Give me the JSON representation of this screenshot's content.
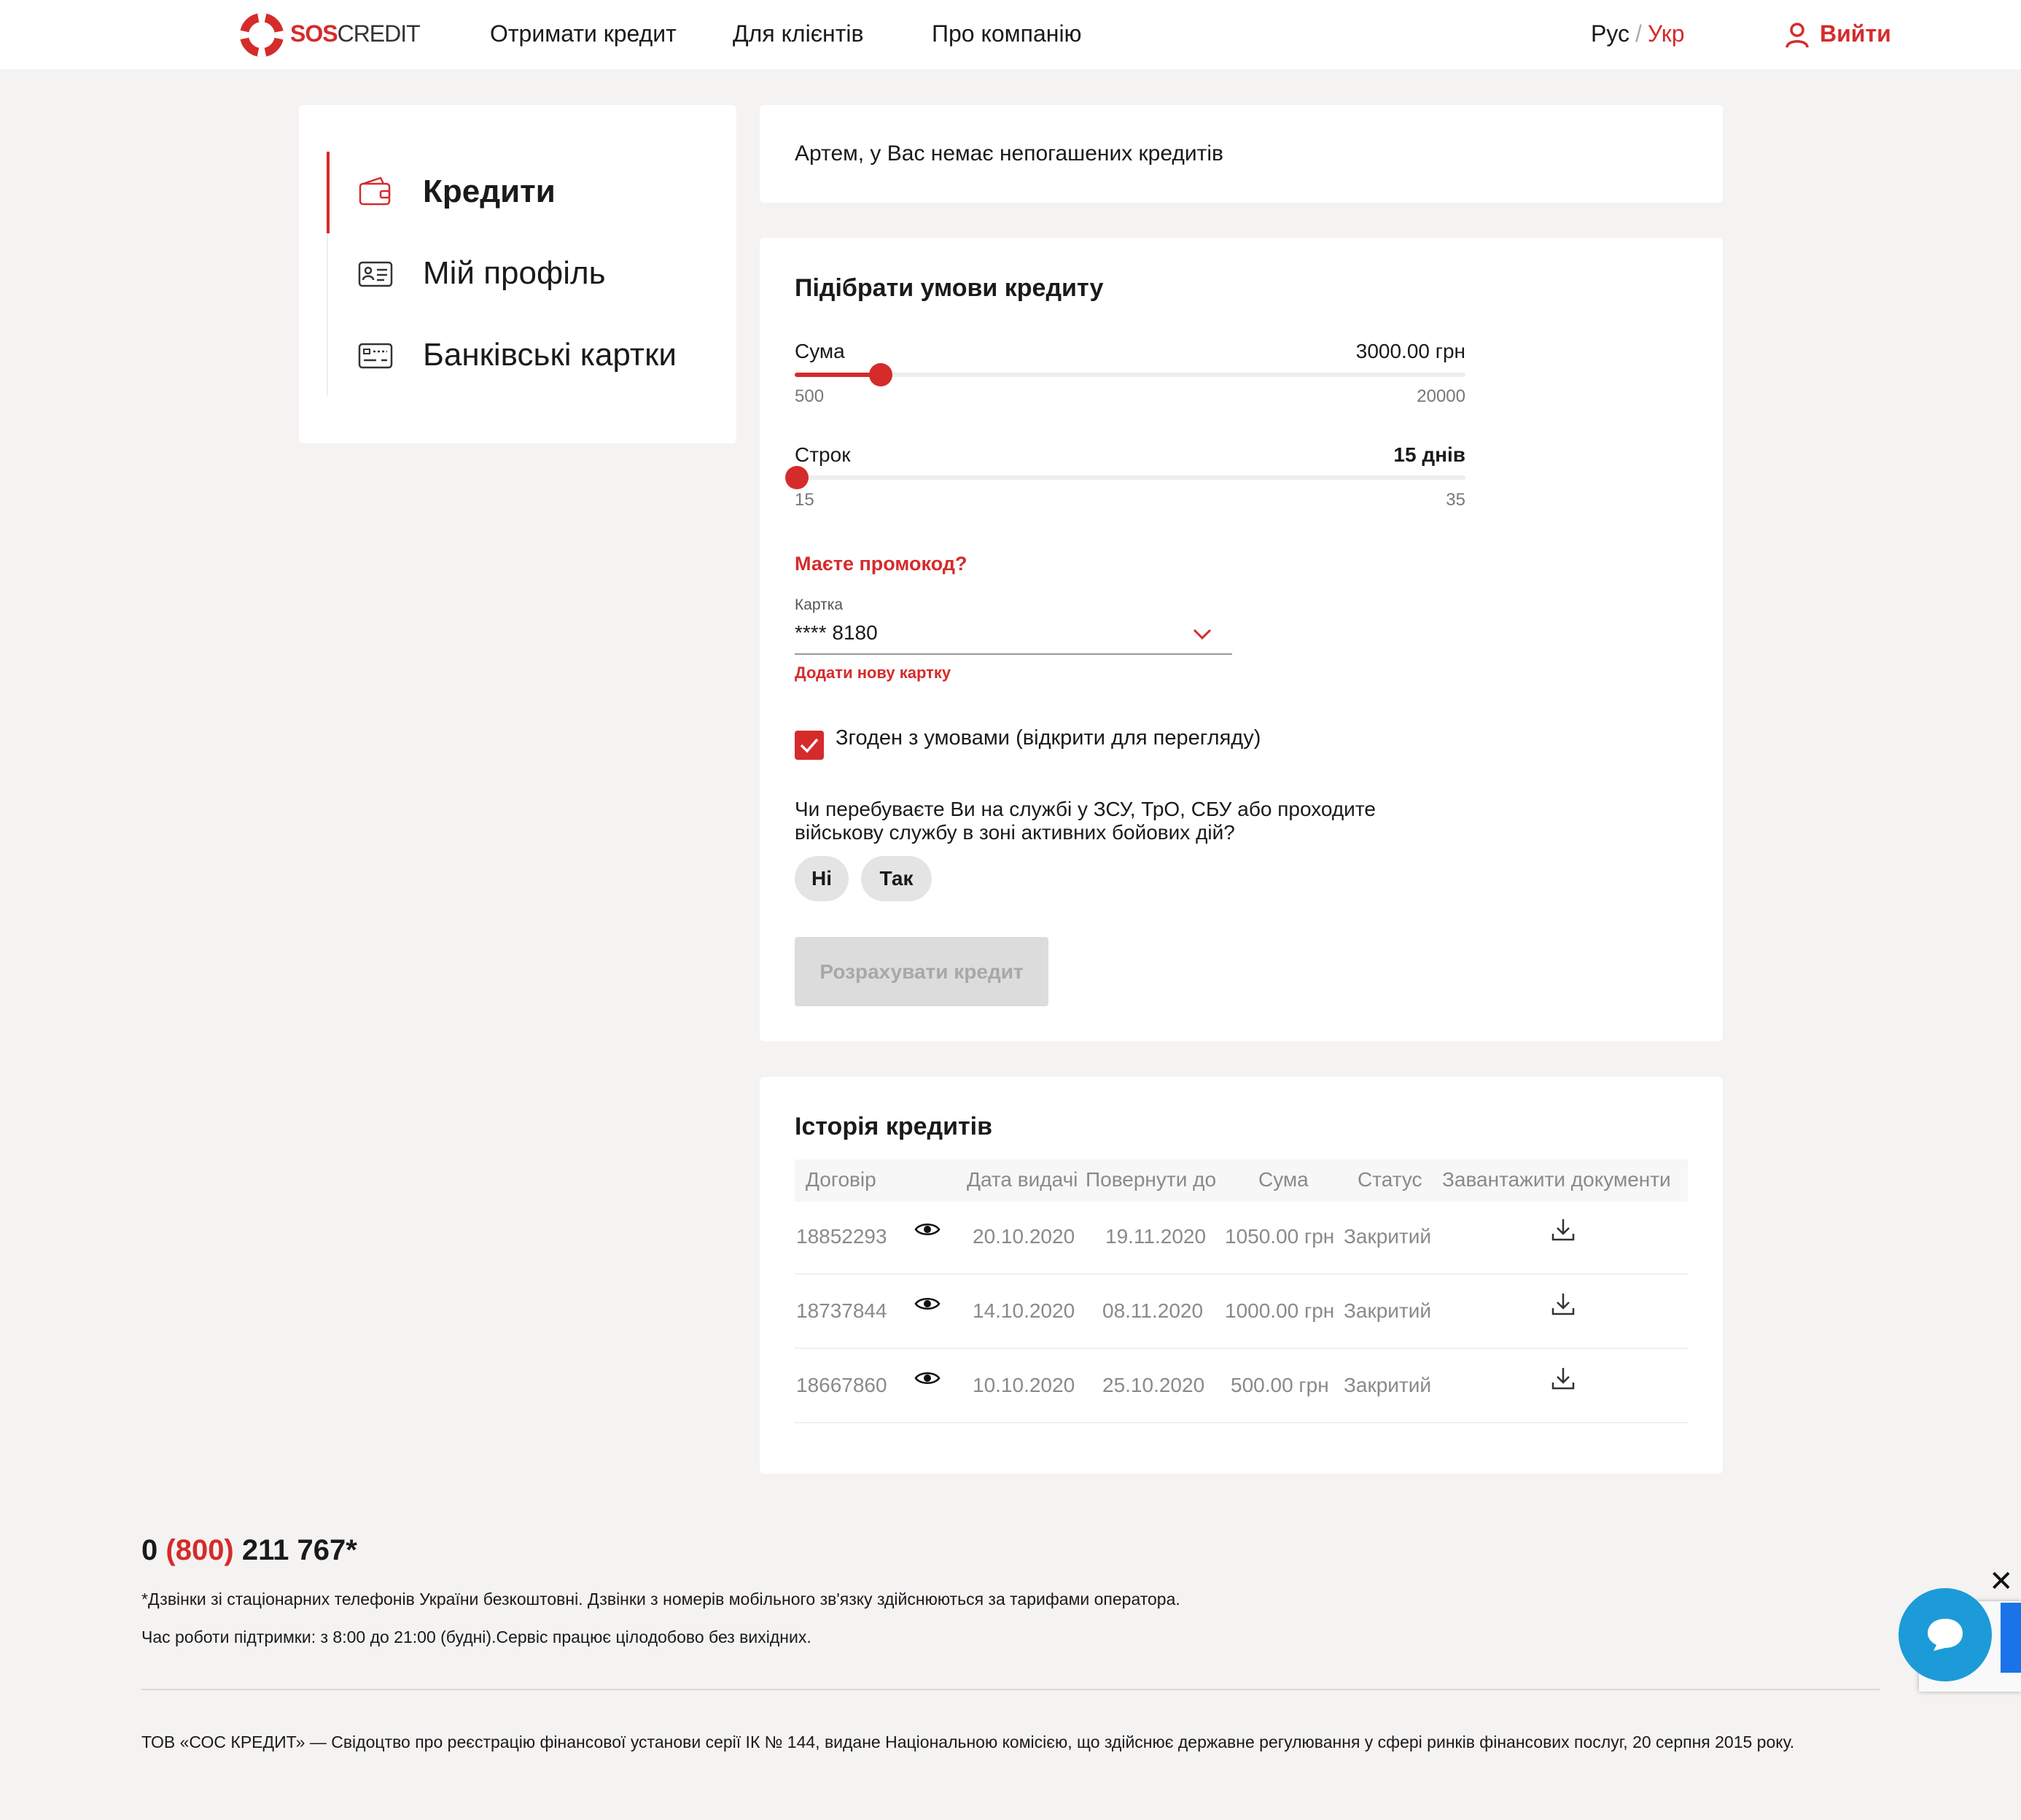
{
  "header": {
    "logo_sos": "SOS",
    "logo_credit": "CREDIT",
    "nav": [
      "Отримати кредит",
      "Для клієнтів",
      "Про компанію"
    ],
    "lang_ru": "Рус",
    "lang_sep": "/",
    "lang_uk": "Укр",
    "logout": "Вийти"
  },
  "sidebar": {
    "items": [
      {
        "label": "Кредити",
        "icon": "wallet-icon",
        "active": true
      },
      {
        "label": "Мій профіль",
        "icon": "id-card-icon",
        "active": false
      },
      {
        "label": "Банківські картки",
        "icon": "bank-card-icon",
        "active": false
      }
    ]
  },
  "notice": "Артем, у Вас немає непогашених кредитів",
  "calculator": {
    "title": "Підібрати умови кредиту",
    "amount": {
      "label": "Сума",
      "value": "3000.00 грн",
      "min": "500",
      "max": "20000",
      "level": 3000,
      "range": [
        500,
        20000
      ]
    },
    "term": {
      "label": "Строк",
      "value": "15 днів",
      "min": "15",
      "max": "35",
      "level": 15,
      "range": [
        15,
        35
      ]
    },
    "promo": "Маєте промокод?",
    "card_label": "Картка",
    "card_value": "**** 8180",
    "add_card": "Додати нову картку",
    "agree": "Згоден з умовами (відкрити для перегляду)",
    "question_line1": "Чи перебуваєте Ви на службі у ЗСУ, ТрО, СБУ або проходите",
    "question_line2": "військову службу в зоні активних бойових дій?",
    "no": "Ні",
    "yes": "Так",
    "submit": "Розрахувати кредит"
  },
  "history": {
    "title": "Історія кредитів",
    "columns": [
      "Договір",
      "Дата видачі",
      "Повернути до",
      "Сума",
      "Статус",
      "Завантажити документи"
    ],
    "rows": [
      {
        "contract": "18852293",
        "issued": "20.10.2020",
        "due": "19.11.2020",
        "amount": "1050.00 грн",
        "status": "Закритий"
      },
      {
        "contract": "18737844",
        "issued": "14.10.2020",
        "due": "08.11.2020",
        "amount": "1000.00 грн",
        "status": "Закритий"
      },
      {
        "contract": "18667860",
        "issued": "10.10.2020",
        "due": "25.10.2020",
        "amount": "500.00 грн",
        "status": "Закритий"
      }
    ]
  },
  "footer": {
    "phone_prefix": "0",
    "phone_code": "(800)",
    "phone_number": "211 767*",
    "note1": "*Дзвінки зі стаціонарних телефонів України безкоштовні. Дзвінки з номерів мобільного зв'язку здійснюються за тарифами оператора.",
    "note2": "Час роботи підтримки: з 8:00 до 21:00 (будні).Сервіс працює цілодобово без вихідних.",
    "legal": "ТОВ «СОС КРЕДИТ» — Свідоцтво про реєстрацію фінансової установи серії ІК № 144, видане Національною комісією, що здійснює державне регулювання у сфері ринків фінансових послуг, 20 серпня 2015 року."
  },
  "colors": {
    "accent": "#d52b2b",
    "chat": "#1d9bd8"
  }
}
